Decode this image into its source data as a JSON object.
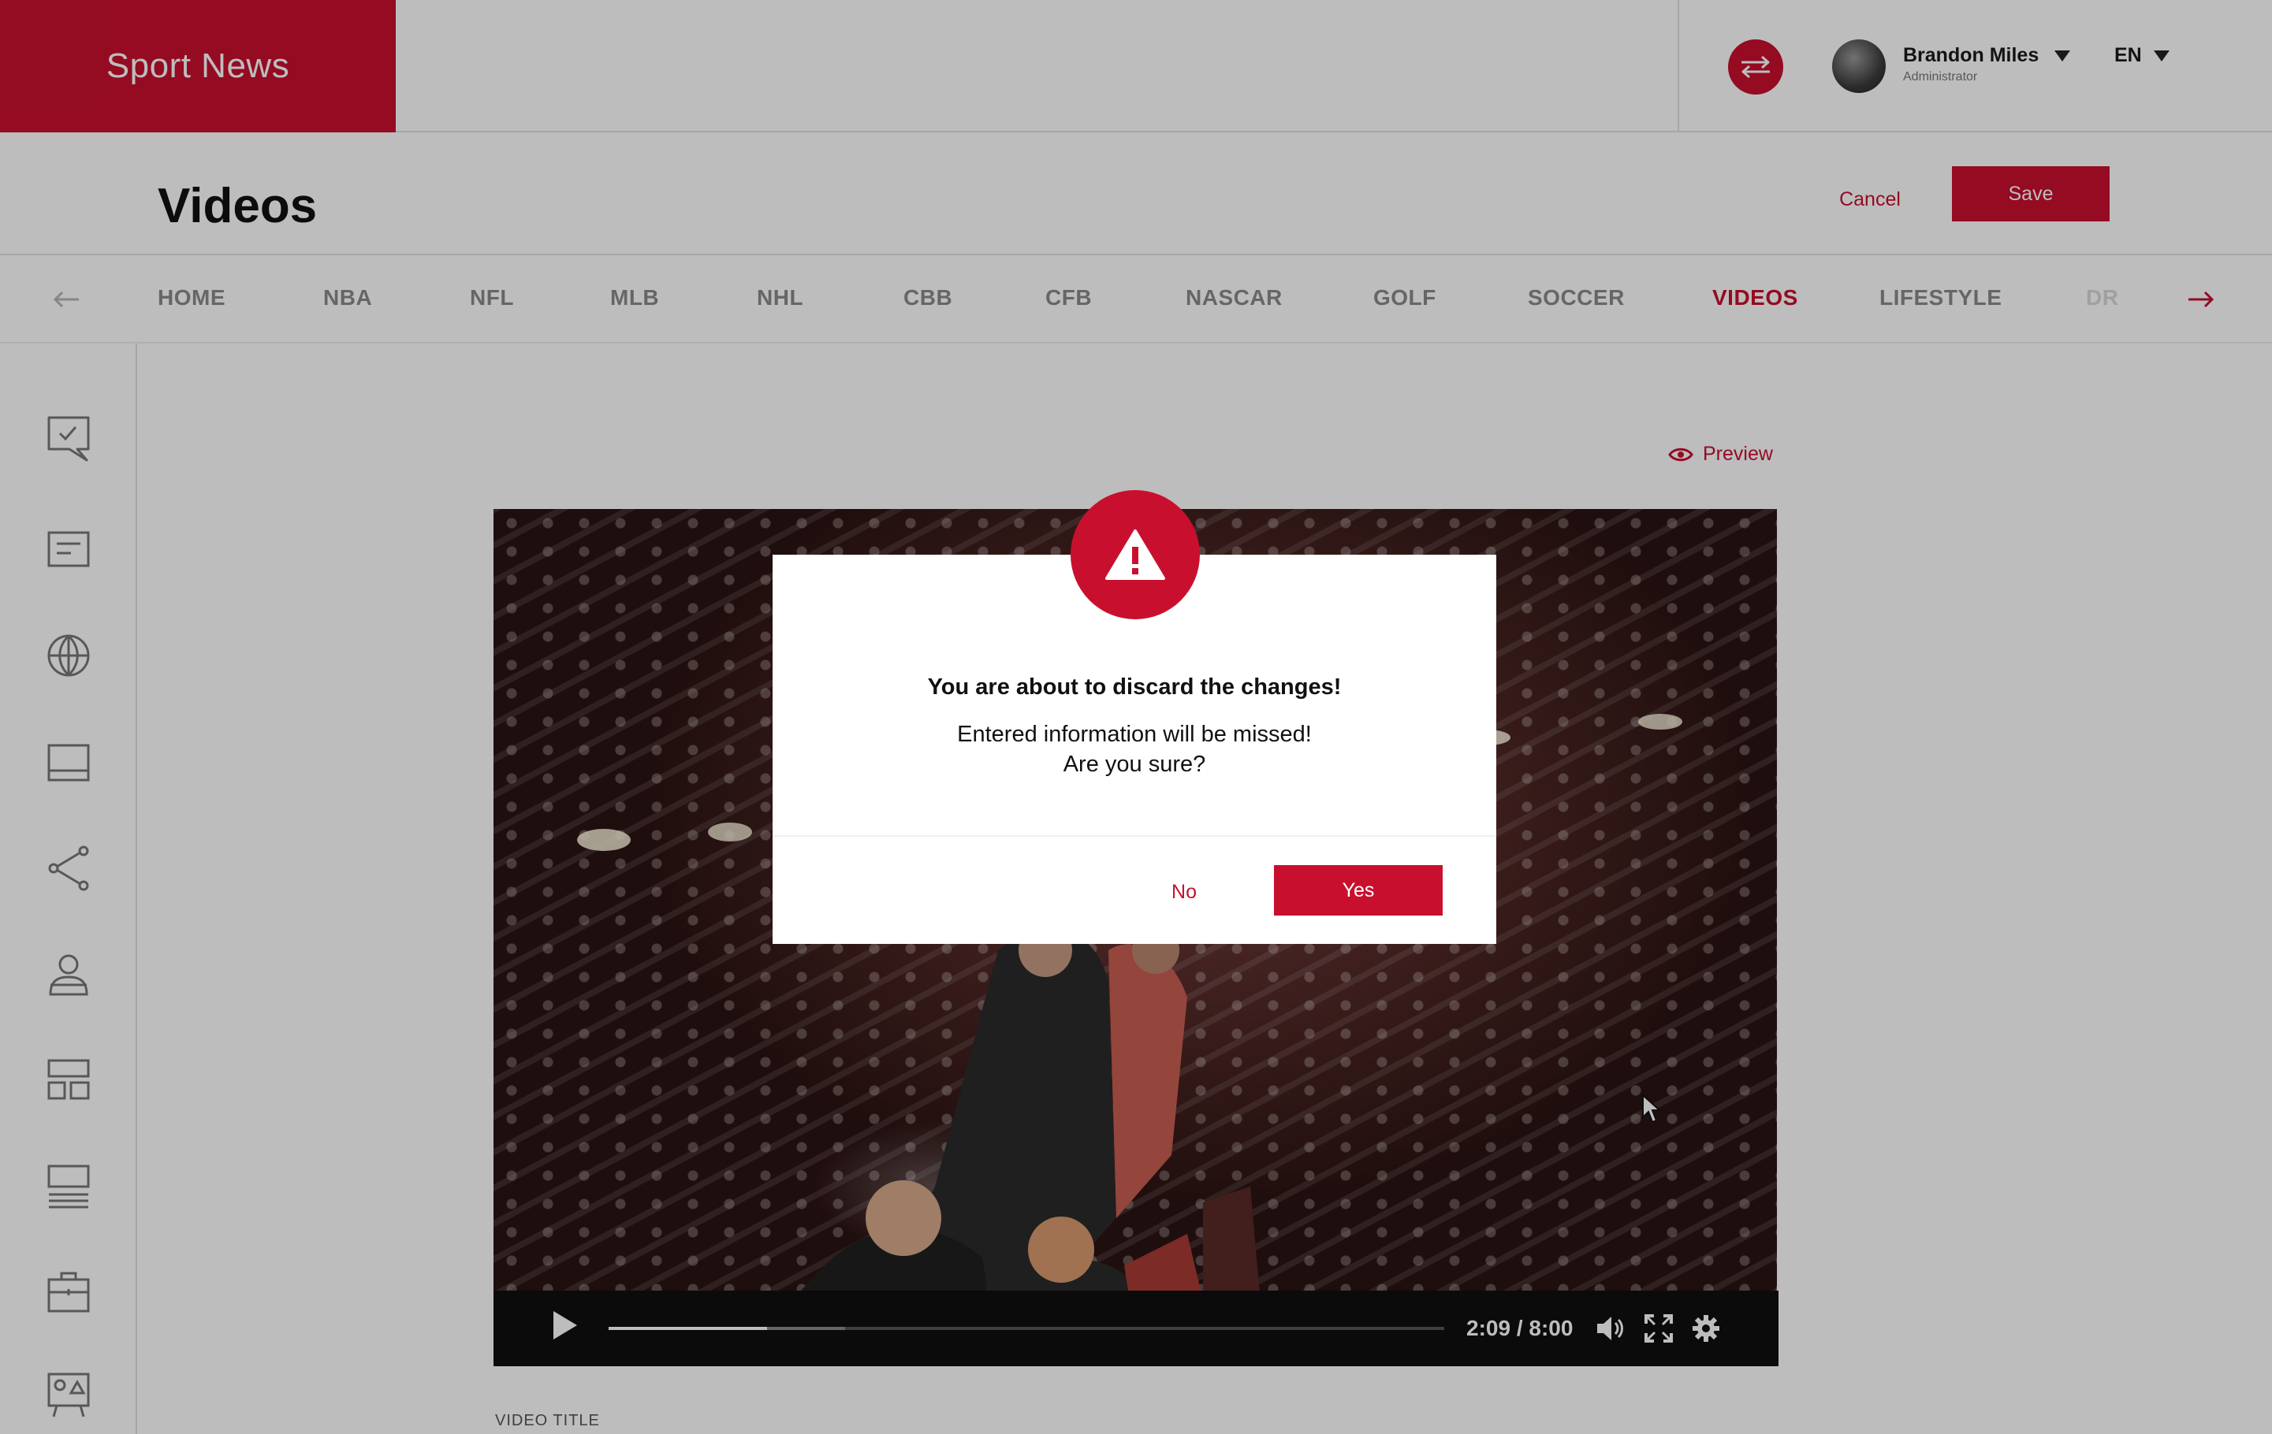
{
  "brand": {
    "name": "Sport News"
  },
  "user": {
    "name": "Brandon Miles",
    "role": "Administrator"
  },
  "language": {
    "selected": "EN"
  },
  "page": {
    "title": "Videos",
    "cancel_label": "Cancel",
    "save_label": "Save"
  },
  "nav": {
    "items": [
      {
        "label": "HOME"
      },
      {
        "label": "NBA"
      },
      {
        "label": "NFL"
      },
      {
        "label": "MLB"
      },
      {
        "label": "NHL"
      },
      {
        "label": "CBB"
      },
      {
        "label": "CFB"
      },
      {
        "label": "NASCAR"
      },
      {
        "label": "GOLF"
      },
      {
        "label": "SOCCER"
      },
      {
        "label": "VIDEOS"
      },
      {
        "label": "LIFESTYLE"
      },
      {
        "label": "DR"
      }
    ],
    "active": "VIDEOS",
    "prev_icon": "arrow-left-icon",
    "next_icon": "arrow-right-icon"
  },
  "sidebar": {
    "icons": [
      "comment-check-icon",
      "article-icon",
      "globe-icon",
      "layout-panel-icon",
      "share-icon",
      "users-icon",
      "dashboard-grid-icon",
      "list-icon",
      "briefcase-icon",
      "media-board-icon"
    ]
  },
  "content": {
    "preview_label": "Preview",
    "video_title_label": "VIDEO TITLE"
  },
  "video": {
    "current_time": "2:09",
    "duration": "8:00",
    "time_display": "2:09 / 8:00",
    "progress_fraction": 0.19
  },
  "modal": {
    "icon": "warning-icon",
    "title": "You are about to discard the changes!",
    "message_line1": "Entered information will be missed!",
    "message_line2": "Are you sure?",
    "no_label": "No",
    "yes_label": "Yes"
  },
  "colors": {
    "accent": "#c8102e",
    "overlay": "rgba(0,0,0,0.26)"
  }
}
